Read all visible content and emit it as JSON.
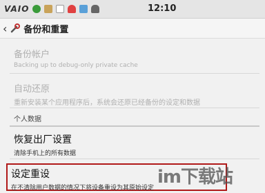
{
  "status_bar": {
    "brand": "VAIO",
    "time": "12:10",
    "icons": [
      "green-circle-icon",
      "image-icon",
      "text-icon",
      "bell-icon",
      "usb-icon",
      "android-icon"
    ]
  },
  "action_bar": {
    "back_icon": "chevron-left-icon",
    "title": "备份和重置"
  },
  "items": [
    {
      "title": "备份帐户",
      "subtitle": "Backing up to debug-only private cache",
      "enabled": false
    },
    {
      "title": "自动还原",
      "subtitle": "重新安装某个应用程序后，系统会还原已经备份的设定和数据",
      "enabled": false
    }
  ],
  "section_header": "个人数据",
  "factory_reset": {
    "title": "恢复出厂设置",
    "subtitle": "清除手机上的所有数据"
  },
  "settings_reset": {
    "title": "设定重设",
    "subtitle": "在不清除用户数据的情况下将设备重设为其原始设定"
  },
  "watermark": "im下载站",
  "colors": {
    "highlight_border": "#b01818"
  }
}
